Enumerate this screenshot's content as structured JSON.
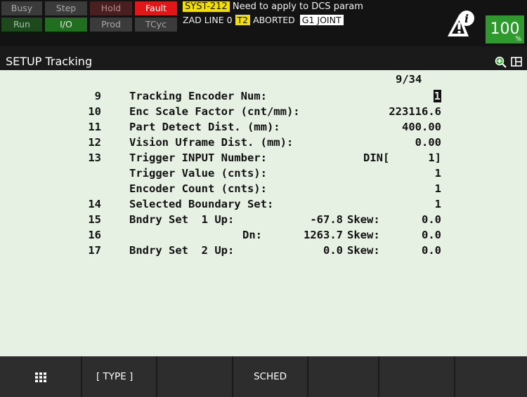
{
  "status_leds": {
    "busy": "Busy",
    "step": "Step",
    "hold": "Hold",
    "fault": "Fault",
    "run": "Run",
    "io": "I/O",
    "prod": "Prod",
    "tcyc": "TCyc"
  },
  "alarm": {
    "code": "SYST-212",
    "text": "Need to apply to DCS param",
    "line": "ZAD LINE 0",
    "mode": "T2",
    "state": "ABORTED",
    "group": "G1 JOINT"
  },
  "override": {
    "value": "100",
    "unit": "%"
  },
  "screen": {
    "title": "SETUP Tracking",
    "page_indicator": "9/34"
  },
  "rows": [
    {
      "num": "9",
      "label": "Tracking Encoder Num:",
      "value": "1"
    },
    {
      "num": "10",
      "label": "Enc Scale Factor (cnt/mm):",
      "value": "223116.6"
    },
    {
      "num": "11",
      "label": "Part Detect Dist. (mm):",
      "value": "400.00"
    },
    {
      "num": "12",
      "label": "Vision Uframe Dist. (mm):",
      "value": "0.00"
    },
    {
      "num": "13",
      "label": "Trigger INPUT Number:",
      "port": "DIN[",
      "value": "1]"
    },
    {
      "num": "",
      "label": "Trigger Value (cnts):",
      "value": "1"
    },
    {
      "num": "",
      "label": "Encoder Count (cnts):",
      "value": "1"
    },
    {
      "num": "14",
      "label": "Selected Boundary Set:",
      "value": "1"
    },
    {
      "num": "15",
      "label": "Bndry Set  1 Up:",
      "pos": "-67.8",
      "skew_label": "Skew:",
      "value": "0.0"
    },
    {
      "num": "16",
      "label": "Dn:",
      "pos": "1263.7",
      "skew_label": "Skew:",
      "value": "0.0"
    },
    {
      "num": "17",
      "label": "Bndry Set  2 Up:",
      "pos": "0.0",
      "skew_label": "Skew:",
      "value": "0.0"
    }
  ],
  "fkeys": {
    "f1": "[ TYPE ]",
    "f3": "SCHED"
  },
  "icons": {
    "info": "info-warning-icon",
    "zoom": "zoom-in-icon",
    "split": "split-screen-icon",
    "menu": "grid-menu-icon"
  }
}
